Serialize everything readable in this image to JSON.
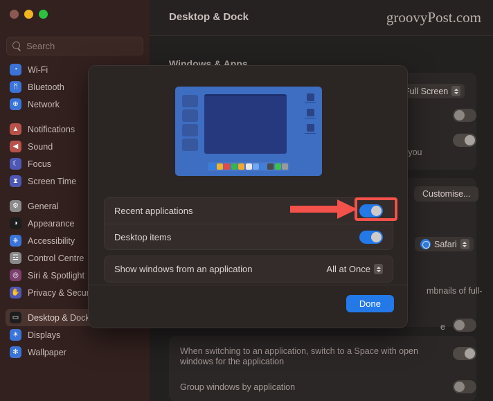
{
  "window": {
    "traffic_lights": [
      "close",
      "minimize",
      "zoom"
    ],
    "search": {
      "placeholder": "Search",
      "value": "",
      "icon": "search-icon"
    }
  },
  "sidebar": {
    "groups": [
      {
        "items": [
          {
            "label": "Wi-Fi",
            "icon": "wifi-icon",
            "color": "#3b73d8",
            "glyph": "◔",
            "selected": false
          },
          {
            "label": "Bluetooth",
            "icon": "bluetooth-icon",
            "color": "#3b73d8",
            "glyph": "ᛗ",
            "selected": false
          },
          {
            "label": "Network",
            "icon": "network-icon",
            "color": "#3b73d8",
            "glyph": "⊕",
            "selected": false
          }
        ]
      },
      {
        "items": [
          {
            "label": "Notifications",
            "icon": "bell-icon",
            "color": "#b7524b",
            "glyph": "▲",
            "selected": false
          },
          {
            "label": "Sound",
            "icon": "speaker-icon",
            "color": "#b7524b",
            "glyph": "◀",
            "selected": false
          },
          {
            "label": "Focus",
            "icon": "moon-icon",
            "color": "#4f57b5",
            "glyph": "☾",
            "selected": false
          },
          {
            "label": "Screen Time",
            "icon": "hourglass-icon",
            "color": "#4f57b5",
            "glyph": "⧗",
            "selected": false
          }
        ]
      },
      {
        "items": [
          {
            "label": "General",
            "icon": "gear-icon",
            "color": "#8a8a8a",
            "glyph": "⚙",
            "selected": false
          },
          {
            "label": "Appearance",
            "icon": "contrast-icon",
            "color": "#1d1d1d",
            "glyph": "◑",
            "selected": false
          },
          {
            "label": "Accessibility",
            "icon": "accessibility-icon",
            "color": "#3b73d8",
            "glyph": "⎈",
            "selected": false
          },
          {
            "label": "Control Centre",
            "icon": "sliders-icon",
            "color": "#8a8a8a",
            "glyph": "☲",
            "selected": false
          },
          {
            "label": "Siri & Spotlight",
            "icon": "siri-icon",
            "color": "#7b3f6d",
            "glyph": "◎",
            "selected": false
          },
          {
            "label": "Privacy & Security",
            "icon": "hand-icon",
            "color": "#4f57b5",
            "glyph": "✋",
            "selected": false
          }
        ]
      },
      {
        "items": [
          {
            "label": "Desktop & Dock",
            "icon": "desktop-icon",
            "color": "#1d1d1d",
            "glyph": "▭",
            "selected": true
          },
          {
            "label": "Displays",
            "icon": "brightness-icon",
            "color": "#3b73d8",
            "glyph": "☀",
            "selected": false
          },
          {
            "label": "Wallpaper",
            "icon": "wallpaper-icon",
            "color": "#3b73d8",
            "glyph": "✻",
            "selected": false
          }
        ]
      }
    ]
  },
  "header": {
    "title": "Desktop & Dock",
    "watermark": "groovyPost.com"
  },
  "background": {
    "section_title": "Windows & Apps",
    "full_screen_value": "Full Screen",
    "when_you_text": "when you",
    "customise_label": "Customise...",
    "safari_label": "Safari",
    "thumbnails_text": "mbnails of full-",
    "switch_space_text": "When switching to an application, switch to a Space with open windows for the application",
    "group_windows_text": "Group windows by application",
    "partial_text": "e"
  },
  "sheet": {
    "illustration": {
      "name": "desktop-preview-illustration",
      "dock_icon_colors": [
        "#2f7fe8",
        "#f0b427",
        "#e6474f",
        "#38b54a",
        "#f0a92a",
        "#e8e8e8",
        "#6fa8f0",
        "#3f7fe0",
        "#4a4a4a",
        "#3cc24a",
        "#9a9a9a"
      ]
    },
    "rows": [
      {
        "label": "Recent applications",
        "control": "toggle",
        "state": "on",
        "highlighted": true
      },
      {
        "label": "Desktop items",
        "control": "toggle",
        "state": "on",
        "highlighted": false
      }
    ],
    "popup_row": {
      "label": "Show windows from an application",
      "value": "All at Once"
    },
    "done_label": "Done"
  },
  "annotation": {
    "arrow_color": "#f4514a",
    "highlight_color": "#f4514a"
  }
}
